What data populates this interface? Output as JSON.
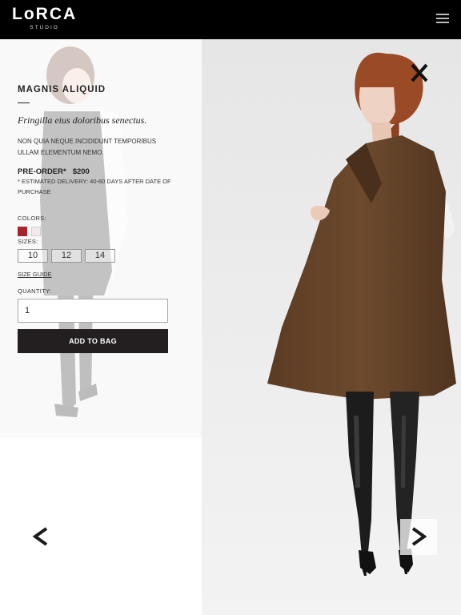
{
  "header": {
    "logo_main": "LoRCA",
    "logo_sub": "STUDIO",
    "menu_icon": "hamburger-menu-icon"
  },
  "product": {
    "title": "MAGNIS ALIQUID",
    "subtitle": "Fringilla eius doloribus senectus.",
    "description": "NON QUIA NEQUE INCIDIDUNT TEMPORIBUS ULLAM ELEMENTUM NEMO.",
    "preorder_label": "PRE-ORDER*",
    "price": "$200",
    "delivery_note": "* ESTIMATED DELIVERY: 40-60 DAYS AFTER DATE OF PURCHASE",
    "colors_label": "COLORS:",
    "colors": [
      "#a8232b",
      "#f2eaea"
    ],
    "sizes_label": "SIZES:",
    "sizes": [
      "10",
      "12",
      "14"
    ],
    "size_guide": "SIZE GUIDE",
    "quantity_label": "QUANTITY:",
    "quantity_value": "1",
    "add_to_bag": "ADD TO BAG"
  },
  "gallery": {
    "close_label": "X",
    "prev_icon": "chevron-left-icon",
    "next_icon": "chevron-right-icon"
  }
}
